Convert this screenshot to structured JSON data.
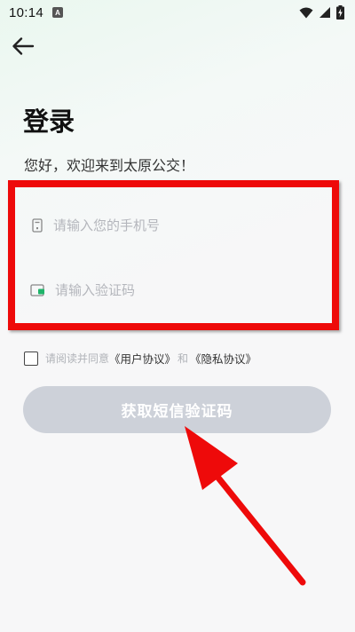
{
  "status_bar": {
    "time": "10:14",
    "notification_icon_letter": "A",
    "icons": [
      "wifi-icon",
      "signal-icon",
      "battery-charging-icon"
    ]
  },
  "header": {
    "back_icon": "arrow-left-icon"
  },
  "login": {
    "title": "登录",
    "subtitle": "您好，欢迎来到太原公交！",
    "phone": {
      "placeholder": "请输入您的手机号",
      "value": "",
      "icon": "phone-icon"
    },
    "code": {
      "placeholder": "请输入验证码",
      "value": "",
      "icon": "verify-card-icon"
    },
    "agreement": {
      "checked": false,
      "prefix": "请阅读并同意",
      "user_agreement": "《用户协议》",
      "and": "和",
      "privacy_agreement": "《隐私协议》"
    },
    "submit_label": "获取短信验证码"
  },
  "colors": {
    "highlight_red": "#ee0a0a",
    "button_disabled": "#cdd1d9",
    "placeholder_gray": "#b4b6bc",
    "accent_green": "#1fb46a"
  }
}
